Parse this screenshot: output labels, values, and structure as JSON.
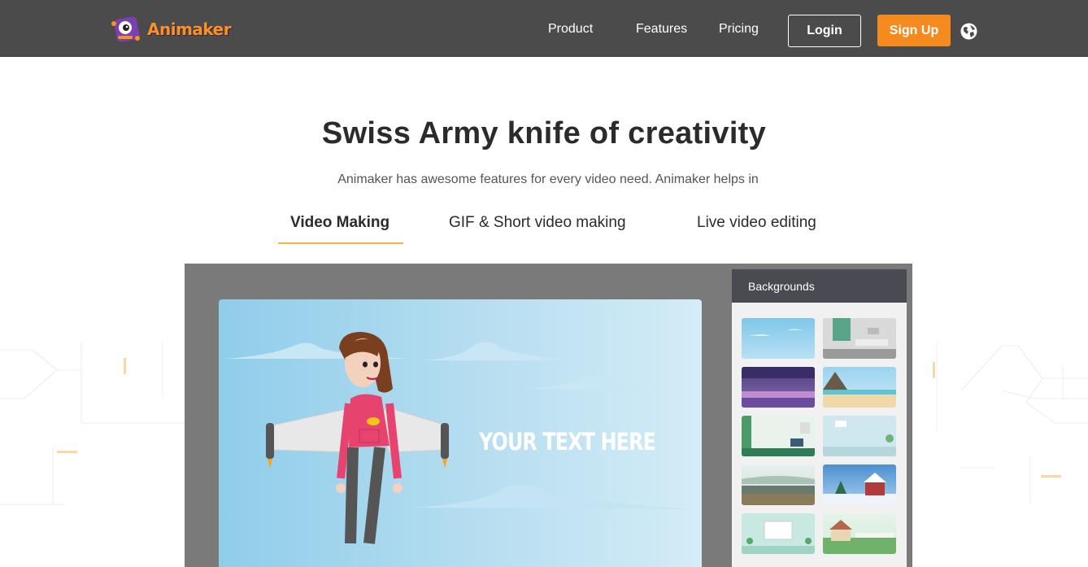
{
  "header": {
    "logo_text": "Animaker",
    "nav": [
      "Product",
      "Features",
      "Pricing"
    ],
    "login_label": "Login",
    "signup_label": "Sign Up",
    "globe_icon": "globe-icon"
  },
  "hero": {
    "title": "Swiss Army knife of creativity",
    "subtitle": "Animaker has awesome features for every video need. Animaker helps in"
  },
  "tabs": [
    {
      "label": "Video Making",
      "active": true
    },
    {
      "label": "GIF & Short video making",
      "active": false
    },
    {
      "label": "Live video editing",
      "active": false
    }
  ],
  "editor": {
    "canvas_text": "YOUR TEXT HERE",
    "panel_title": "Backgrounds",
    "backgrounds": [
      "sky-background",
      "room-background",
      "purple-city-background",
      "beach-background",
      "green-room-background",
      "office-background",
      "road-background",
      "snow-house-background",
      "presentation-background",
      "garden-background"
    ]
  },
  "colors": {
    "header_bg": "#4b4b4b",
    "accent_orange": "#f58a1f",
    "tab_underline": "#f5b83d",
    "logo_orange": "#f7931e",
    "logo_purple": "#7a3fb0"
  }
}
